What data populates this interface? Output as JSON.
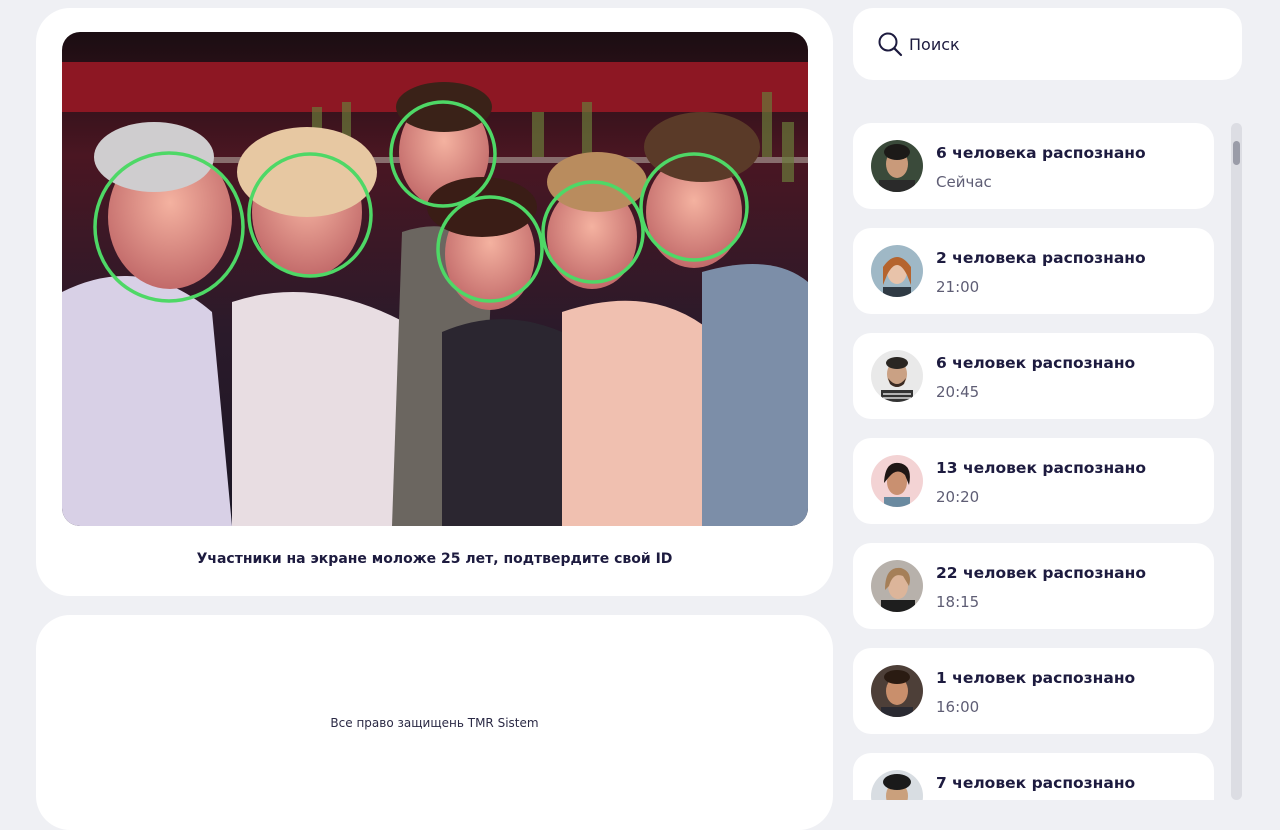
{
  "main": {
    "photo": {
      "subject": "group-photo",
      "face_marker_color": "#4ed866"
    },
    "caption": "Участники на экране моложе 25 лет, подтвердите свой ID"
  },
  "footer": {
    "copyright": "Все право защищень TMR Sistem"
  },
  "search": {
    "icon": "search-icon",
    "placeholder": "Поиск"
  },
  "feed": {
    "items": [
      {
        "title": "6 человека распознано",
        "time": "Сейчас"
      },
      {
        "title": "2 человека распознано",
        "time": "21:00"
      },
      {
        "title": "6 человек распознано",
        "time": "20:45"
      },
      {
        "title": "13 человек распознано",
        "time": "20:20"
      },
      {
        "title": "22 человек распознано",
        "time": "18:15"
      },
      {
        "title": "1 человек распознано",
        "time": "16:00"
      },
      {
        "title": "7 человек распознано",
        "time": ""
      }
    ]
  },
  "colors": {
    "background": "#eff0f4",
    "card": "#ffffff",
    "text": "#1d1b3f",
    "face_marker": "#4ed866"
  }
}
